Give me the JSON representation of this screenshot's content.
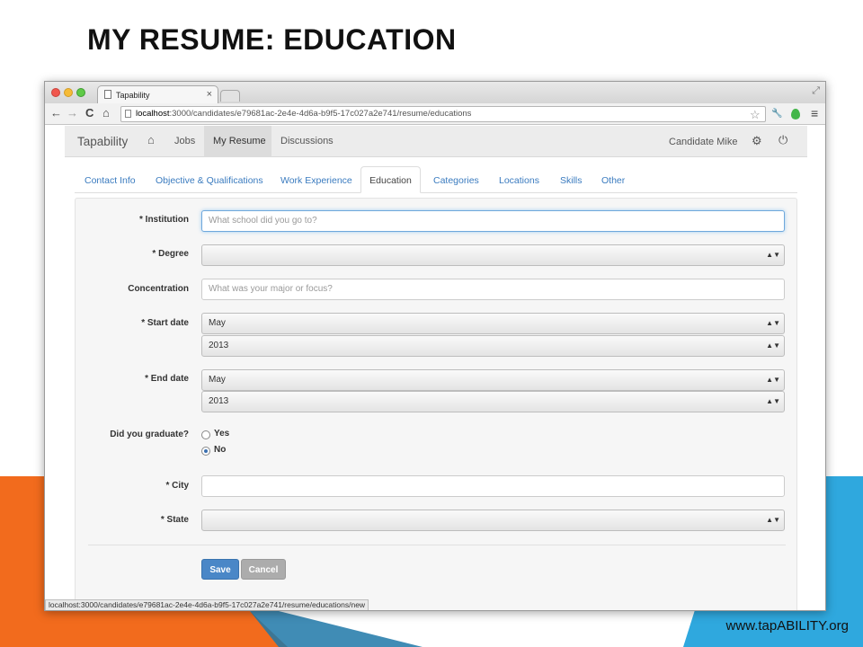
{
  "slide": {
    "title": "MY RESUME: EDUCATION",
    "footer_url": "www.tapABILITY.org",
    "colors": {
      "orange": "#f26b1d",
      "blue": "#2fa8de"
    }
  },
  "browser": {
    "tab_title": "Tapability",
    "tab_close": "×",
    "url_host": "localhost",
    "url_rest": ":3000/candidates/e79681ac-2e4e-4d6a-b9f5-17c027a2e741/resume/educations",
    "status_url": "localhost:3000/candidates/e79681ac-2e4e-4d6a-b9f5-17c027a2e741/resume/educations/new",
    "icons": {
      "back": "←",
      "forward": "→",
      "reload": "C",
      "home": "⌂",
      "star": "☆",
      "wrench": "🔧",
      "menu": "≡"
    }
  },
  "nav": {
    "brand": "Tapability",
    "items": [
      "Jobs",
      "My Resume",
      "Discussions"
    ],
    "active": "My Resume",
    "user": "Candidate Mike",
    "icons": {
      "home": "⌂",
      "gear": "⚙",
      "power": "⏻"
    }
  },
  "tabs": {
    "items": [
      "Contact Info",
      "Objective & Qualifications",
      "Work Experience",
      "Education",
      "Categories",
      "Locations",
      "Skills",
      "Other"
    ],
    "active": "Education"
  },
  "form": {
    "institution": {
      "label": "* Institution",
      "placeholder": "What school did you go to?"
    },
    "degree": {
      "label": "* Degree",
      "value": ""
    },
    "concentration": {
      "label": "Concentration",
      "placeholder": "What was your major or focus?"
    },
    "start_date": {
      "label": "* Start date",
      "month": "May",
      "year": "2013"
    },
    "end_date": {
      "label": "* End date",
      "month": "May",
      "year": "2013"
    },
    "graduated": {
      "label": "Did you graduate?",
      "options": [
        "Yes",
        "No"
      ],
      "selected": "No"
    },
    "city": {
      "label": "* City",
      "value": ""
    },
    "state": {
      "label": "* State",
      "value": ""
    },
    "select_arrows": "▲▼",
    "save": "Save",
    "cancel": "Cancel"
  }
}
